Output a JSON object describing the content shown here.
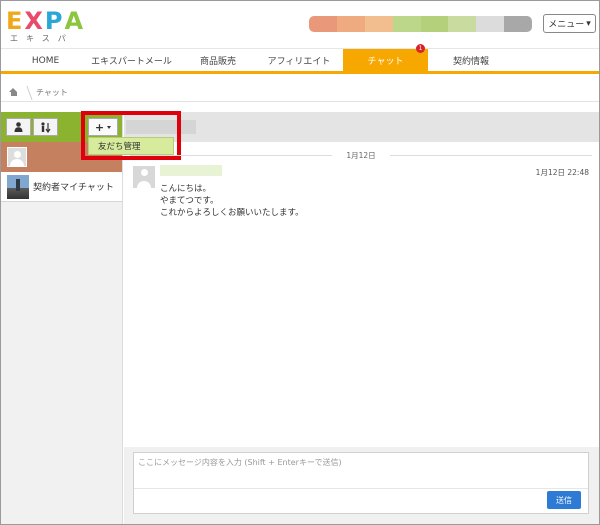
{
  "logo": {
    "letters": [
      "E",
      "X",
      "P",
      "A"
    ],
    "kana": "エキスパ"
  },
  "header": {
    "menu_label": "メニュー",
    "menu_icon": "caret-down-icon",
    "user_bar_colors": [
      "#e9987a",
      "#f0aa80",
      "#f3be8f",
      "#bcd68a",
      "#b5d07a",
      "#c9db9f",
      "#dcdcdc",
      "#a8a8a8"
    ]
  },
  "nav": {
    "items": [
      {
        "label": "HOME",
        "active": false
      },
      {
        "label": "エキスパートメール",
        "active": false
      },
      {
        "label": "商品販売",
        "active": false
      },
      {
        "label": "アフィリエイト",
        "active": false
      },
      {
        "label": "チャット",
        "active": true,
        "badge": "1"
      },
      {
        "label": "契約情報",
        "active": false
      }
    ],
    "accent_color": "#f6a800"
  },
  "breadcrumb": {
    "home_icon": "home-icon",
    "current": "チャット"
  },
  "sidebar": {
    "header_color": "#8bb32f",
    "buttons": [
      {
        "icon": "person-icon"
      },
      {
        "icon": "sort-people-icon"
      }
    ],
    "contacts": [
      {
        "name": "契約者マイチャット",
        "icon": "contact-thumbnail-icon"
      }
    ]
  },
  "toolbar": {
    "add_icon": "plus-icon",
    "dropdown_items": [
      {
        "label": "友だち管理"
      }
    ]
  },
  "chat": {
    "date_divider": "1月12日",
    "messages": [
      {
        "time": "1月12日 22:48",
        "lines": [
          "こんにちは。",
          "やまてつです。",
          "これからよろしくお願いいたします。"
        ]
      }
    ]
  },
  "composer": {
    "placeholder": "ここにメッセージ内容を入力 (Shift + Enterキーで送信)",
    "send_label": "送信",
    "send_color": "#2d7bd5"
  }
}
